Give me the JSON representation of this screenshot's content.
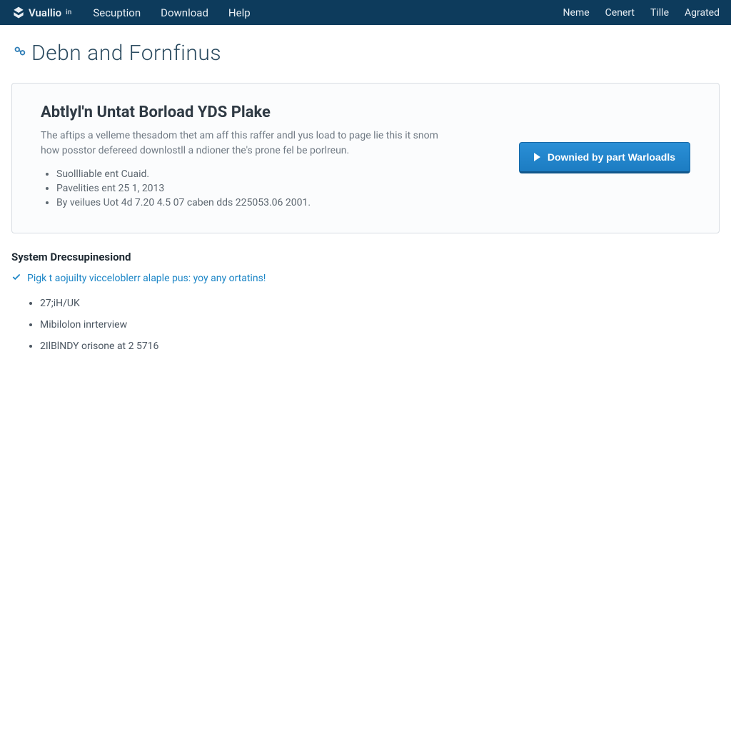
{
  "brand": "Vuallio",
  "brand_suffix": "in",
  "nav_left": [
    "Secuption",
    "Download",
    "Help"
  ],
  "nav_right": [
    "Neme",
    "Cenert",
    "Tille",
    "Agrated"
  ],
  "page_title": "Debn and Fornfinus",
  "card": {
    "title": "Abtlyl'n Untat Borload YDS Plake",
    "desc": "The aftips a velleme thesadom thet am aff this raffer andl yus load to page lie this it snom how posstor defereed downlostll a ndioner the's prone fel be porlreun.",
    "items": [
      "Suollliable ent Cuaid.",
      "Pavelities ent 25 1, 2013",
      "By veilues Uot 4d 7.20 4.5 07 caben dds 225053.06 2001."
    ],
    "button": "Downied by part Warloadls"
  },
  "section_heading": "System Drecsupinesiond",
  "check_line": "Pigk t aojuilty vicceloblerr alaple pus: yoy any ortatins!",
  "reqs": [
    "27;iH/UK",
    "Mibilolon inrterview",
    "2IlBlNDY orisone at 2 5716"
  ]
}
